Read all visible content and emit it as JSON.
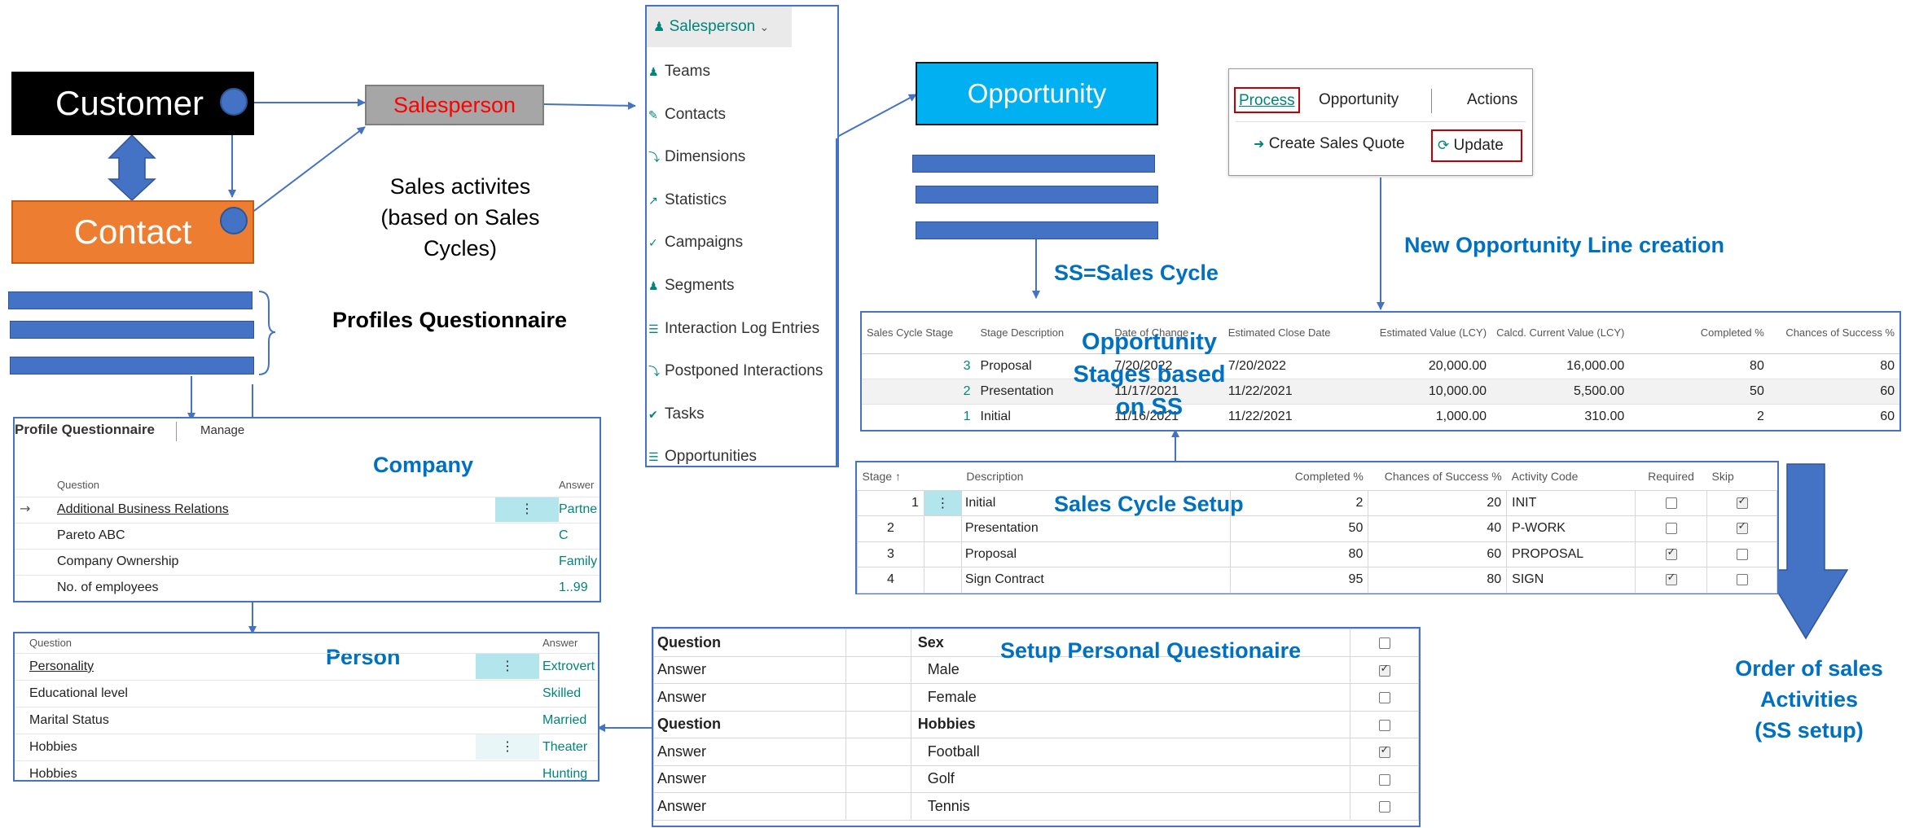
{
  "entities": {
    "customer": "Customer",
    "contact": "Contact",
    "salesperson": "Salesperson",
    "opportunity": "Opportunity"
  },
  "labels": {
    "sales_activities": "Sales activites",
    "sales_activities_sub": "(based on Sales Cycles)",
    "profiles_questionnaire": "Profiles Questionnaire",
    "ss_sales_cycle": "SS=Sales Cycle",
    "new_opportunity_line": "New Opportunity Line creation",
    "opportunity_stages": [
      "Opportunity",
      "Stages based",
      "on SS"
    ],
    "sales_cycle_setup": "Sales Cycle Setup",
    "order_of_sales": [
      "Order of sales",
      "Activities",
      "(SS setup)"
    ],
    "company": "Company",
    "person": "Person",
    "setup_personal_questionnaire": "Setup Personal Questionaire"
  },
  "salesperson_menu": {
    "header": "Salesperson",
    "items": [
      "Teams",
      "Contacts",
      "Dimensions",
      "Statistics",
      "Campaigns",
      "Segments",
      "Interaction Log Entries",
      "Postponed Interactions",
      "Tasks",
      "Opportunities"
    ]
  },
  "opportunity_actions": {
    "tabs": [
      "Process",
      "Opportunity",
      "Actions"
    ],
    "create_sales_quote": "Create Sales Quote",
    "update": "Update"
  },
  "opportunity_lines": {
    "headers": [
      "Sales Cycle Stage",
      "Stage Description",
      "Date of Change",
      "Estimated Close Date",
      "Estimated Value (LCY)",
      "Calcd. Current Value (LCY)",
      "Completed %",
      "Chances of Success %"
    ],
    "rows": [
      [
        "3",
        "Proposal",
        "7/20/2022",
        "7/20/2022",
        "20,000.00",
        "16,000.00",
        "80",
        "80"
      ],
      [
        "2",
        "Presentation",
        "11/17/2021",
        "11/22/2021",
        "10,000.00",
        "5,500.00",
        "50",
        "60"
      ],
      [
        "1",
        "Initial",
        "11/16/2021",
        "11/22/2021",
        "1,000.00",
        "310.00",
        "2",
        "60"
      ]
    ]
  },
  "sales_cycle_stages": {
    "headers": [
      "Stage ↑",
      "Description",
      "Completed %",
      "Chances of Success %",
      "Activity Code",
      "Required",
      "Skip"
    ],
    "rows": [
      {
        "stage": "1",
        "description": "Initial",
        "completed": "2",
        "chances": "20",
        "activity": "INIT",
        "required": false,
        "skip": true
      },
      {
        "stage": "2",
        "description": "Presentation",
        "completed": "50",
        "chances": "40",
        "activity": "P-WORK",
        "required": false,
        "skip": true
      },
      {
        "stage": "3",
        "description": "Proposal",
        "completed": "80",
        "chances": "60",
        "activity": "PROPOSAL",
        "required": true,
        "skip": false
      },
      {
        "stage": "4",
        "description": "Sign Contract",
        "completed": "95",
        "chances": "80",
        "activity": "SIGN",
        "required": true,
        "skip": false
      }
    ]
  },
  "profile_questionnaire": {
    "title": "Profile Questionnaire",
    "manage": "Manage",
    "col_question": "Question",
    "col_answer": "Answer",
    "rows": [
      {
        "question": "Additional Business Relations",
        "answer": "Partner"
      },
      {
        "question": "Pareto ABC",
        "answer": "C"
      },
      {
        "question": "Company Ownership",
        "answer": "Family"
      },
      {
        "question": "No. of employees",
        "answer": "1..99"
      }
    ]
  },
  "person_questionnaire": {
    "col_question": "Question",
    "col_answer": "Answer",
    "rows": [
      {
        "question": "Personality",
        "answer": "Extrovert"
      },
      {
        "question": "Educational level",
        "answer": "Skilled"
      },
      {
        "question": "Marital Status",
        "answer": "Married"
      },
      {
        "question": "Hobbies",
        "answer": "Theater"
      },
      {
        "question": "Hobbies",
        "answer": "Hunting"
      }
    ]
  },
  "personal_setup": {
    "rows": [
      {
        "type": "Question",
        "desc": "Sex",
        "checked": false,
        "bold": true
      },
      {
        "type": "Answer",
        "desc": "Male",
        "checked": true,
        "bold": false
      },
      {
        "type": "Answer",
        "desc": "Female",
        "checked": false,
        "bold": false
      },
      {
        "type": "Question",
        "desc": "Hobbies",
        "checked": false,
        "bold": true
      },
      {
        "type": "Answer",
        "desc": "Football",
        "checked": true,
        "bold": false
      },
      {
        "type": "Answer",
        "desc": "Golf",
        "checked": false,
        "bold": false
      },
      {
        "type": "Answer",
        "desc": "Tennis",
        "checked": false,
        "bold": false
      }
    ]
  },
  "icons": [
    "person-icon",
    "team-icon",
    "contact-card-icon",
    "dimensions-icon",
    "statistics-icon",
    "campaign-icon",
    "segment-icon",
    "log-icon",
    "postponed-icon",
    "tasks-icon",
    "opportunity-icon",
    "sales-quote-icon",
    "refresh-icon",
    "more-options-icon",
    "row-arrow-icon"
  ],
  "colors": {
    "accent": "#4472c4",
    "opportunity": "#00b0f0",
    "contact": "#ed7d31",
    "salesperson": "#a6a6a6",
    "label_blue": "#0070c0",
    "salesperson_text": "#ff0000"
  }
}
